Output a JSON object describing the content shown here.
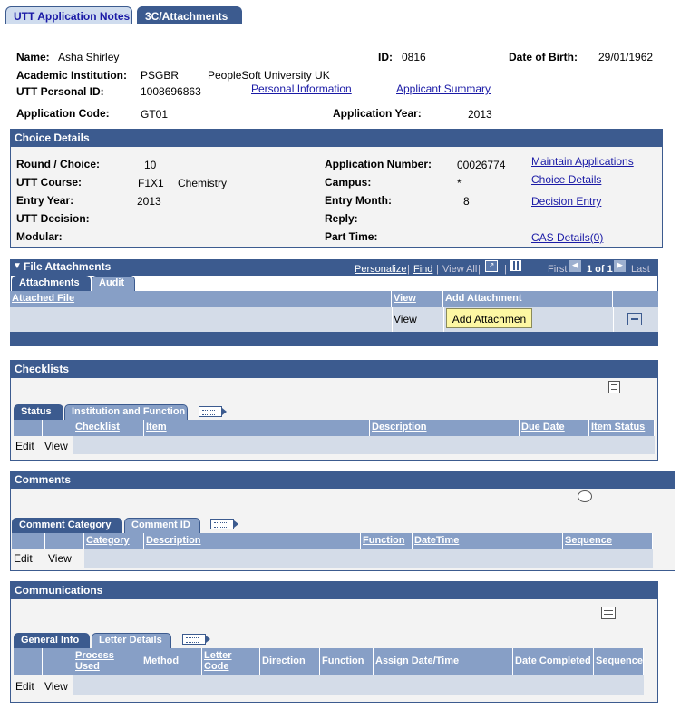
{
  "tabs": {
    "notes": "UTT Application Notes",
    "attachments": "3C/Attachments"
  },
  "header": {
    "name_label": "Name:",
    "name": "Asha Shirley",
    "id_label": "ID:",
    "id": "0816",
    "dob_label": "Date of Birth:",
    "dob": "29/01/1962",
    "inst_label": "Academic Institution:",
    "inst_code": "PSGBR",
    "inst_name": "PeopleSoft University UK",
    "pid_label": "UTT Personal ID:",
    "pid": "1008696863",
    "personal_info_link": "Personal Information",
    "applicant_summary_link": "Applicant Summary",
    "app_code_label": "Application Code:",
    "app_code": "GT01",
    "app_year_label": "Application Year:",
    "app_year": "2013"
  },
  "choice": {
    "title": "Choice Details",
    "round_label": "Round / Choice:",
    "round": "10",
    "course_label": "UTT Course:",
    "course_code": "F1X1",
    "course_name": "Chemistry",
    "entry_year_label": "Entry Year:",
    "entry_year": "2013",
    "decision_label": "UTT Decision:",
    "modular_label": "Modular:",
    "appnum_label": "Application Number:",
    "appnum": "00026774",
    "campus_label": "Campus:",
    "campus": "*",
    "entry_month_label": "Entry Month:",
    "entry_month": "8",
    "reply_label": "Reply:",
    "parttime_label": "Part Time:",
    "links": {
      "maintain": "Maintain Applications",
      "choice": "Choice Details",
      "decision": "Decision Entry",
      "cas": "CAS Details(0)"
    }
  },
  "files": {
    "title": "File Attachments",
    "personalize": "Personalize",
    "find": "Find",
    "viewall": "View All",
    "first": "First",
    "pager": "1 of 1",
    "last": "Last",
    "tabs": {
      "attachments": "Attachments",
      "audit": "Audit"
    },
    "cols": {
      "attached": "Attached File",
      "view": "View",
      "add": "Add Attachment"
    },
    "row": {
      "view": "View",
      "add_button": "Add Attachmen"
    }
  },
  "checklists": {
    "title": "Checklists",
    "tabs": {
      "status": "Status",
      "inst": "Institution and Function"
    },
    "cols": {
      "checklist": "Checklist",
      "item": "Item",
      "description": "Description",
      "due": "Due Date",
      "status": "Item Status"
    },
    "row": {
      "edit": "Edit",
      "view": "View"
    }
  },
  "comments": {
    "title": "Comments",
    "tabs": {
      "category": "Comment Category",
      "id": "Comment ID"
    },
    "cols": {
      "category": "Category",
      "description": "Description",
      "function": "Function",
      "datetime": "DateTime",
      "sequence": "Sequence"
    },
    "row": {
      "edit": "Edit",
      "view": "View"
    }
  },
  "comms": {
    "title": "Communications",
    "tabs": {
      "general": "General Info",
      "letter": "Letter Details"
    },
    "cols": {
      "process": "Process Used",
      "method": "Method",
      "letter": "Letter Code",
      "direction": "Direction",
      "function": "Function",
      "assign": "Assign Date/Time",
      "completed": "Date Completed",
      "sequence": "Sequence"
    },
    "row": {
      "edit": "Edit",
      "view": "View"
    }
  },
  "colors": {
    "header": "#3c5b8f",
    "tableHead": "#879fc6",
    "rowBg": "#d4dce8",
    "link": "#1a1aa6",
    "button": "#fdf7a3"
  }
}
